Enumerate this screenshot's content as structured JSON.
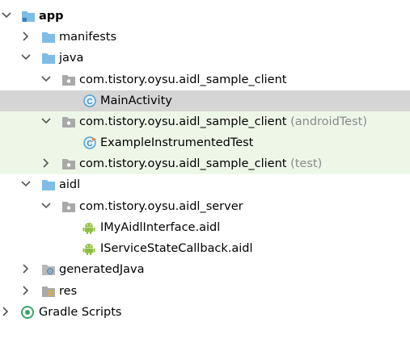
{
  "tree": {
    "app": "app",
    "manifests": "manifests",
    "java": "java",
    "pkg_client": "com.tistory.oysu.aidl_sample_client",
    "main_activity": "MainActivity",
    "pkg_client_android_test": "com.tistory.oysu.aidl_sample_client",
    "android_test_suffix": "(androidTest)",
    "example_test": "ExampleInstrumentedTest",
    "pkg_client_test": "com.tistory.oysu.aidl_sample_client",
    "test_suffix": "(test)",
    "aidl": "aidl",
    "pkg_server": "com.tistory.oysu.aidl_server",
    "aidl_file_1": "IMyAidlInterface.aidl",
    "aidl_file_2": "IServiceStateCallback.aidl",
    "generated_java": "generatedJava",
    "res": "res",
    "gradle_scripts": "Gradle Scripts"
  },
  "colors": {
    "selected_row": "#d5d5d5",
    "test_row": "#eef7e7",
    "folder_blue": "#7fbce6",
    "android_green": "#8fbf3f",
    "class_icon": "#4aa3d8",
    "gradle_green": "#3ea36b"
  }
}
